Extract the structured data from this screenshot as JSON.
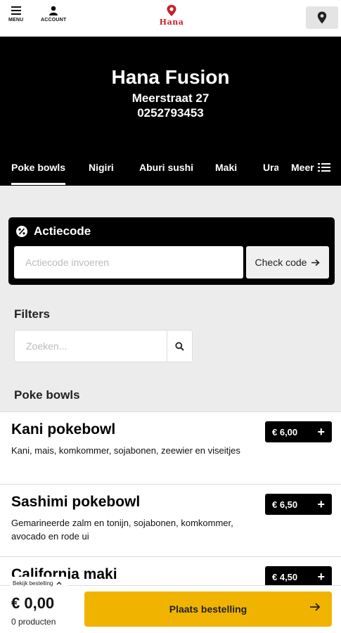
{
  "header": {
    "menu_label": "MENU",
    "account_label": "ACCOUNT",
    "logo_text": "Hana"
  },
  "hero": {
    "title": "Hana Fusion",
    "address": "Meerstraat 27",
    "phone": "0252793453"
  },
  "tabs": {
    "items": [
      "Poke bowls",
      "Nigiri",
      "Aburi sushi",
      "Maki",
      "Uramaki"
    ],
    "active": "Poke bowls",
    "more_label": "Meer"
  },
  "promo": {
    "title": "Actiecode",
    "placeholder": "Actiecode invoeren",
    "button_label": "Check code"
  },
  "filters": {
    "title": "Filters",
    "search_placeholder": "Zoeken..."
  },
  "section": {
    "title": "Poke bowls"
  },
  "products": [
    {
      "name": "Kani pokebowl",
      "description": "Kani, mais, komkommer, sojabonen, zeewier en viseitjes",
      "price": "€ 6,00"
    },
    {
      "name": "Sashimi pokebowl",
      "description": "Gemarineerde zalm en tonijn, sojabonen, komkommer, avocado en rode ui",
      "price": "€ 6,50"
    },
    {
      "name": "California maki",
      "description": "",
      "price": "€ 4,50"
    }
  ],
  "cart": {
    "view_label": "Bekijk bestelling",
    "total": "€ 0,00",
    "count": "0 producten",
    "place_label": "Plaats bestelling"
  },
  "colors": {
    "accent": "#f0b400",
    "brand_red": "#c8202a",
    "hero_bg": "#000000"
  }
}
